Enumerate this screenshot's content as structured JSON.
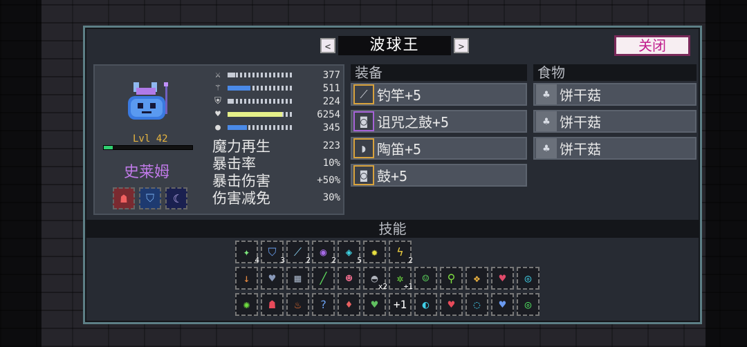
{
  "title": "波球王",
  "nav": {
    "prev": "<",
    "next": ">"
  },
  "close_label": "关闭",
  "character": {
    "name": "史莱姆",
    "level": "Lvl 42",
    "xp_fraction": 0.1
  },
  "stats": [
    {
      "icon": "sword-icon",
      "glyph": "⚔",
      "value": "377",
      "bar_fill": 0.12,
      "bar_color": "#c7ccd6"
    },
    {
      "icon": "wand-icon",
      "glyph": "⚚",
      "value": "511",
      "bar_fill": 0.35,
      "bar_color": "#4a8ae8"
    },
    {
      "icon": "shield-icon",
      "glyph": "⛨",
      "value": "224",
      "bar_fill": 0.08,
      "bar_color": "#c7ccd6"
    },
    {
      "icon": "heart-icon",
      "glyph": "♥",
      "value": "6254",
      "bar_fill": 0.85,
      "bar_color": "#e6f08a"
    },
    {
      "icon": "boot-icon",
      "glyph": "●",
      "value": "345",
      "bar_fill": 0.3,
      "bar_color": "#4a8ae8"
    }
  ],
  "text_stats": [
    {
      "label": "魔力再生",
      "value": "223"
    },
    {
      "label": "暴击率",
      "value": "10%"
    },
    {
      "label": "暴击伤害",
      "value": "+50%"
    },
    {
      "label": "伤害减免",
      "value": "30%"
    }
  ],
  "equipment_header": "装备",
  "equipment": [
    {
      "name": "钓竿+5",
      "icon": "fishing-rod-icon",
      "glyph": "⟋",
      "border": "#d8a23c"
    },
    {
      "name": "诅咒之鼓+5",
      "icon": "drum-icon",
      "glyph": "◙",
      "border": "#a662d8"
    },
    {
      "name": "陶笛+5",
      "icon": "ocarina-icon",
      "glyph": "◗",
      "border": "#d8a23c"
    },
    {
      "name": "鼓+5",
      "icon": "drum-icon",
      "glyph": "◙",
      "border": "#d8a23c"
    }
  ],
  "food_header": "食物",
  "food": [
    {
      "name": "饼干菇",
      "icon": "mushroom-icon",
      "glyph": "♣"
    },
    {
      "name": "饼干菇",
      "icon": "mushroom-icon",
      "glyph": "♣"
    },
    {
      "name": "饼干菇",
      "icon": "mushroom-icon",
      "glyph": "♣"
    }
  ],
  "skills_header": "技能",
  "skill_rows": [
    [
      {
        "icon": "sparkle-icon",
        "glyph": "✦",
        "color": "#7de87d",
        "badge": "4"
      },
      {
        "icon": "shield-blue-icon",
        "glyph": "⛉",
        "color": "#6aa0f0",
        "badge": "3"
      },
      {
        "icon": "staff-icon",
        "glyph": "⟋",
        "color": "#8ad0f0",
        "badge": "2"
      },
      {
        "icon": "purple-orb-icon",
        "glyph": "◉",
        "color": "#a66ae8",
        "badge": "2"
      },
      {
        "icon": "cyan-gem-icon",
        "glyph": "◈",
        "color": "#40d8e8",
        "badge": "5"
      },
      {
        "icon": "sun-icon",
        "glyph": "✹",
        "color": "#e8e040",
        "badge": ""
      },
      {
        "icon": "lightning-icon",
        "glyph": "ϟ",
        "color": "#f0d040",
        "badge": "2"
      }
    ],
    [
      {
        "icon": "arrow-down-icon",
        "glyph": "↓",
        "color": "#e88a40",
        "badge": ""
      },
      {
        "icon": "heart-armor-icon",
        "glyph": "♥",
        "color": "#8898b8",
        "badge": ""
      },
      {
        "icon": "bandage-icon",
        "glyph": "▦",
        "color": "#9aa6b8",
        "badge": ""
      },
      {
        "icon": "green-sword-icon",
        "glyph": "╱",
        "color": "#60e060",
        "badge": ""
      },
      {
        "icon": "red-face-icon",
        "glyph": "☻",
        "color": "#e86a8a",
        "badge": ""
      },
      {
        "icon": "grey-boot-icon",
        "glyph": "◓",
        "color": "#b0b4bc",
        "badge": "x2"
      },
      {
        "icon": "green-gear-icon",
        "glyph": "✲",
        "color": "#70e040",
        "badge": "+1"
      },
      {
        "icon": "green-face-icon",
        "glyph": "☺",
        "color": "#60e060",
        "badge": ""
      },
      {
        "icon": "green-figure-icon",
        "glyph": "⚲",
        "color": "#80e040",
        "badge": ""
      },
      {
        "icon": "colorful-icon",
        "glyph": "❖",
        "color": "#e8b040",
        "badge": ""
      },
      {
        "icon": "blue-heart-icon",
        "glyph": "♥",
        "color": "#e04a6a",
        "badge": ""
      },
      {
        "icon": "cyan-ring-icon",
        "glyph": "◎",
        "color": "#40d0e8",
        "badge": ""
      }
    ],
    [
      {
        "icon": "green-swirl-icon",
        "glyph": "✺",
        "color": "#70e040",
        "badge": ""
      },
      {
        "icon": "red-beast-icon",
        "glyph": "☗",
        "color": "#e84a5a",
        "badge": ""
      },
      {
        "icon": "fire-icon",
        "glyph": "♨",
        "color": "#f07030",
        "badge": ""
      },
      {
        "icon": "question-icon",
        "glyph": "?",
        "color": "#6aa0f0",
        "badge": ""
      },
      {
        "icon": "heart-diamond-icon",
        "glyph": "♦",
        "color": "#e86060",
        "badge": ""
      },
      {
        "icon": "green-heart-icon",
        "glyph": "♥",
        "color": "#60c060",
        "badge": ""
      },
      {
        "icon": "plus-one-icon",
        "glyph": "+1",
        "color": "#ffffff",
        "badge": ""
      },
      {
        "icon": "cyan-crescent-icon",
        "glyph": "◐",
        "color": "#40d0e8",
        "badge": ""
      },
      {
        "icon": "red-heart-plus-icon",
        "glyph": "♥",
        "color": "#e84a5a",
        "badge": ""
      },
      {
        "icon": "cyan-swirl-icon",
        "glyph": "◌",
        "color": "#40c8e8",
        "badge": ""
      },
      {
        "icon": "blue-armor-icon",
        "glyph": "♥",
        "color": "#6a9af0",
        "badge": ""
      },
      {
        "icon": "green-ring-icon",
        "glyph": "◎",
        "color": "#50e060",
        "badge": ""
      }
    ]
  ]
}
